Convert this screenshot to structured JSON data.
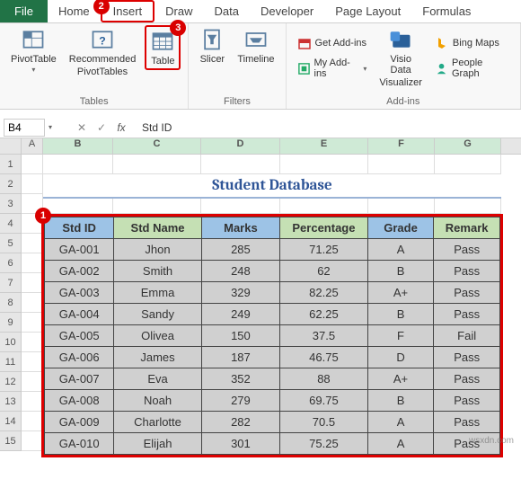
{
  "tabs": {
    "file": "File",
    "home": "Home",
    "insert": "Insert",
    "draw": "Draw",
    "data": "Data",
    "developer": "Developer",
    "pagelayout": "Page Layout",
    "formulas": "Formulas"
  },
  "ribbon": {
    "pivot": "PivotTable",
    "recpivot_l1": "Recommended",
    "recpivot_l2": "PivotTables",
    "table": "Table",
    "slicer": "Slicer",
    "timeline": "Timeline",
    "getaddins": "Get Add-ins",
    "myaddins": "My Add-ins",
    "visio_l1": "Visio Data",
    "visio_l2": "Visualizer",
    "bing": "Bing Maps",
    "people": "People Graph",
    "grp_tables": "Tables",
    "grp_filters": "Filters",
    "grp_addins": "Add-ins"
  },
  "markers": {
    "m1": "1",
    "m2": "2",
    "m3": "3"
  },
  "bar": {
    "name": "B4",
    "fx": "fx",
    "value": "Std ID"
  },
  "cols": {
    "A": "A",
    "B": "B",
    "C": "C",
    "D": "D",
    "E": "E",
    "F": "F",
    "G": "G"
  },
  "rows": [
    "1",
    "2",
    "3",
    "4",
    "5",
    "6",
    "7",
    "8",
    "9",
    "10",
    "11",
    "12",
    "13",
    "14",
    "15"
  ],
  "title": "Student Database",
  "hdr": {
    "id": "Std ID",
    "name": "Std Name",
    "marks": "Marks",
    "pct": "Percentage",
    "grade": "Grade",
    "remark": "Remark"
  },
  "data": [
    {
      "id": "GA-001",
      "name": "Jhon",
      "marks": "285",
      "pct": "71.25",
      "grade": "A",
      "remark": "Pass"
    },
    {
      "id": "GA-002",
      "name": "Smith",
      "marks": "248",
      "pct": "62",
      "grade": "B",
      "remark": "Pass"
    },
    {
      "id": "GA-003",
      "name": "Emma",
      "marks": "329",
      "pct": "82.25",
      "grade": "A+",
      "remark": "Pass"
    },
    {
      "id": "GA-004",
      "name": "Sandy",
      "marks": "249",
      "pct": "62.25",
      "grade": "B",
      "remark": "Pass"
    },
    {
      "id": "GA-005",
      "name": "Olivea",
      "marks": "150",
      "pct": "37.5",
      "grade": "F",
      "remark": "Fail"
    },
    {
      "id": "GA-006",
      "name": "James",
      "marks": "187",
      "pct": "46.75",
      "grade": "D",
      "remark": "Pass"
    },
    {
      "id": "GA-007",
      "name": "Eva",
      "marks": "352",
      "pct": "88",
      "grade": "A+",
      "remark": "Pass"
    },
    {
      "id": "GA-008",
      "name": "Noah",
      "marks": "279",
      "pct": "69.75",
      "grade": "B",
      "remark": "Pass"
    },
    {
      "id": "GA-009",
      "name": "Charlotte",
      "marks": "282",
      "pct": "70.5",
      "grade": "A",
      "remark": "Pass"
    },
    {
      "id": "GA-010",
      "name": "Elijah",
      "marks": "301",
      "pct": "75.25",
      "grade": "A",
      "remark": "Pass"
    }
  ],
  "watermark": "wsxdn.com",
  "colw": {
    "A": 24,
    "B": 78,
    "C": 98,
    "D": 88,
    "E": 98,
    "F": 74,
    "G": 74
  }
}
